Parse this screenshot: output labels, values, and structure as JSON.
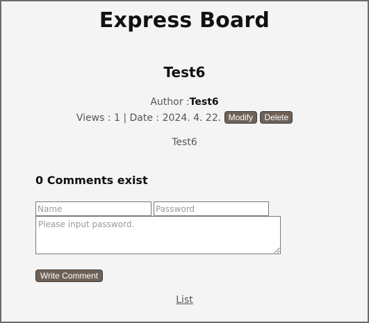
{
  "header": {
    "site_title": "Express Board"
  },
  "post": {
    "title": "Test6",
    "author_label": "Author :",
    "author_name": "Test6",
    "views_label": "Views : 1 | Date : 2024. 4. 22.",
    "modify_label": "Modify",
    "delete_label": "Delete",
    "content": "Test6"
  },
  "comments": {
    "count_text": "0 Comments exist",
    "name_placeholder": "Name",
    "password_placeholder": "Password",
    "comment_placeholder": "Please input password.",
    "write_label": "Write Comment"
  },
  "footer": {
    "list_label": "List"
  },
  "colors": {
    "button_bg": "#6e6258",
    "frame_border": "#6b6b6b",
    "page_bg": "#f4f4f4"
  }
}
